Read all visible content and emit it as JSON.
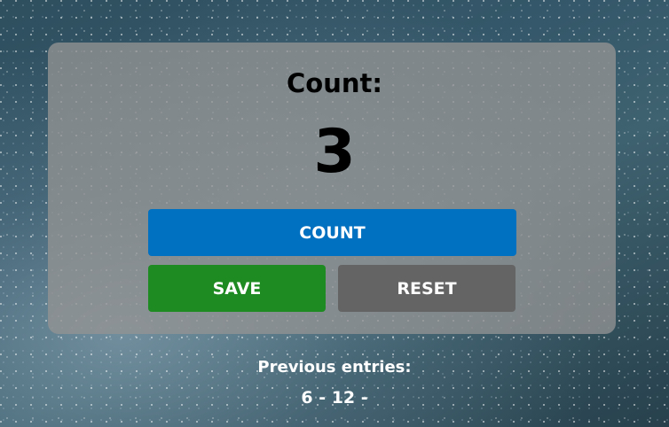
{
  "counter": {
    "label": "Count:",
    "value": "3"
  },
  "buttons": {
    "count_label": "COUNT",
    "save_label": "SAVE",
    "reset_label": "RESET"
  },
  "previous": {
    "title": "Previous entries:",
    "entries_text": "6 - 12 -"
  },
  "colors": {
    "count_button": "#0070c0",
    "save_button": "#1e8a22",
    "reset_button": "#646464",
    "card_background": "#949494"
  }
}
